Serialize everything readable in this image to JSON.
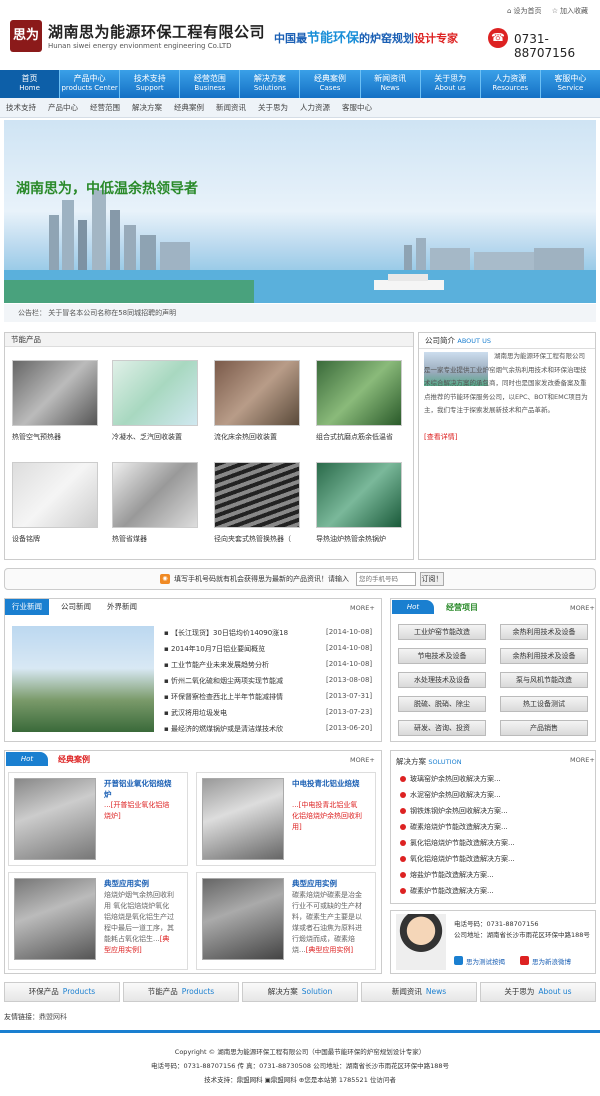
{
  "header": {
    "logo_text": "思为",
    "company_cn": "湖南思为能源环保工程有限公司",
    "company_en": "Hunan siwei energy envionment engineering Co.LTD",
    "slogan_pre": "中国最",
    "slogan_bold": "节能环保",
    "slogan_mid": "的炉窑规划",
    "slogan_red": "设计专家",
    "top_link_1": "设为首页",
    "top_link_2": "加入收藏",
    "phone": "0731-88707156"
  },
  "nav": [
    {
      "cn": "首页",
      "en": "Home"
    },
    {
      "cn": "产品中心",
      "en": "products Center"
    },
    {
      "cn": "技术支持",
      "en": "Support"
    },
    {
      "cn": "经营范围",
      "en": "Business"
    },
    {
      "cn": "解决方案",
      "en": "Solutions"
    },
    {
      "cn": "经典案例",
      "en": "Cases"
    },
    {
      "cn": "新闻资讯",
      "en": "News"
    },
    {
      "cn": "关于思为",
      "en": "About us"
    },
    {
      "cn": "人力资源",
      "en": "Resources"
    },
    {
      "cn": "客服中心",
      "en": "Service"
    }
  ],
  "subnav": [
    "技术支持",
    "产品中心",
    "经营范围",
    "解决方案",
    "经典案例",
    "新闻资讯",
    "关于思为",
    "人力资源",
    "客服中心"
  ],
  "banner": {
    "text": "湖南思为，中低温余热领导者"
  },
  "notice": "公告栏：  关于冒名本公司名称在58同城招聘的声明",
  "products": {
    "title": "节能产品",
    "items": [
      "热管空气预热器",
      "冷凝水、乏汽回收装置",
      "流化床余热回收装置",
      "组合式抗磨点筋余低温省",
      "设备铭牌",
      "热管省煤器",
      "径向夹套式热管换热器（",
      "导热油炉热管余热锅炉"
    ]
  },
  "about": {
    "title": "公司简介",
    "title_en": "ABOUT US",
    "text": "湖南思为能源环保工程有限公司是一家专业提供工业炉窑烟气余热利用技术和环保治理技术综合解决方案的承包商，同时也是国家发改委备案及重点推荐的节能环保服务公司，以EPC、BOT和EMC项目为主，我们专注于探索发展新技术和产品革新。",
    "more": "[查看详情]"
  },
  "subscribe": {
    "text": "填写手机号码就有机会获得思为最新的产品资讯！请输入",
    "placeholder": "您的手机号码",
    "button": "订阅！"
  },
  "news": {
    "tabs": [
      "行业新闻",
      "公司新闻",
      "外界新闻"
    ],
    "more": "MORE+",
    "items": [
      {
        "title": "【长江现货】30日铝均价14090涨18",
        "date": "[2014-10-08]"
      },
      {
        "title": "2014年10月7日铝业要闻概览",
        "date": "[2014-10-08]"
      },
      {
        "title": "工业节能产业未来发展趋势分析",
        "date": "[2014-10-08]"
      },
      {
        "title": "忻州二氧化硫和烟尘两项实现节能减",
        "date": "[2013-08-08]"
      },
      {
        "title": "环保督察检查西北上半年节能减排情",
        "date": "[2013-07-31]"
      },
      {
        "title": "武汉将用垃圾发电",
        "date": "[2013-07-23]"
      },
      {
        "title": "最经济的燃煤锅炉或是清洁煤技术欣",
        "date": "[2013-06-20]"
      }
    ]
  },
  "business": {
    "hot": "Hot",
    "title": "经营项目",
    "more": "MORE+",
    "items": [
      "工业炉窑节能改造",
      "余热利用技术及设备",
      "节电技术及设备",
      "余热利用技术及设备",
      "水处理技术及设备",
      "泵与风机节能改造",
      "脱硫、脱硝、除尘",
      "热工设备测试",
      "研发、咨询、投资",
      "产品销售"
    ]
  },
  "cases": {
    "hot": "Hot",
    "title": "经典案例",
    "more": "MORE+",
    "items": [
      {
        "title": "开普铝业氧化铝焙烧炉",
        "desc": "...[开普铝业氧化铝焙烧炉]",
        "link": ""
      },
      {
        "title": "中电投青北铝业焙烧",
        "desc": "...[中电投青北铝业氧化铝焙烧炉余热回收利用]",
        "link": ""
      },
      {
        "title": "典型应用实例",
        "desc": "焙烧炉烟气余热回收利用 氧化铝焙烧炉氧化铝焙烧是氧化铝生产过程中最后一道工序，其能耗占氧化铝生...",
        "link": "[典型应用实例]"
      },
      {
        "title": "典型应用实例",
        "desc": "碳素焙烧炉碳素是冶金行业不可或缺的生产材料，碳素生产主要是以煤或者石油焦为原料进行煅烧而成，碳素焙烧...",
        "link": "[典型应用实例]"
      }
    ]
  },
  "solutions": {
    "title": "解决方案",
    "title_en": "SOLUTION",
    "more": "MORE+",
    "items": [
      "玻璃窑炉余热回收解决方案...",
      "水泥窑炉余热回收解决方案...",
      "钢铁炼钢炉余热回收解决方案...",
      "碳素焙烧炉节能改造解决方案...",
      "氯化铝焙烧炉节能改造解决方案...",
      "氧化铝焙烧炉节能改造解决方案...",
      "熔盐炉节能改造解决方案...",
      "碳素炉节能改造解决方案..."
    ]
  },
  "contact": {
    "phone": "电话号码：0731-88707156",
    "address": "公司地址：湖南省长沙市雨花区环保中路188号",
    "qq1": "思为测试按揭",
    "qq2": "思为新浪微博"
  },
  "bottom_tabs": [
    {
      "cn": "环保产品",
      "en": "Products"
    },
    {
      "cn": "节能产品",
      "en": "Products"
    },
    {
      "cn": "解决方案",
      "en": "Solution"
    },
    {
      "cn": "新闻资讯",
      "en": "News"
    },
    {
      "cn": "关于思为",
      "en": "About us"
    }
  ],
  "friend_links": {
    "label": "友情链接：",
    "item": "鼎盟网科"
  },
  "footer": {
    "line1": "Copyright © 湖南思为能源环保工程有限公司（中国最节能环保的炉窑规划设计专家）",
    "line2": "电话号码：0731-88707156  传 真：0731-88730508  公司地址：湖南省长沙市雨花区环保中路188号",
    "line3": "技术支持：鼎盟网科  ▣鼎盟网科  ⊕您是本站第 1785521 位访问者"
  },
  "colors": {
    "nav_blue": "#1a7fd0",
    "red": "#d22",
    "title_blue": "#1a5fb4",
    "green": "#2a8a2a"
  }
}
